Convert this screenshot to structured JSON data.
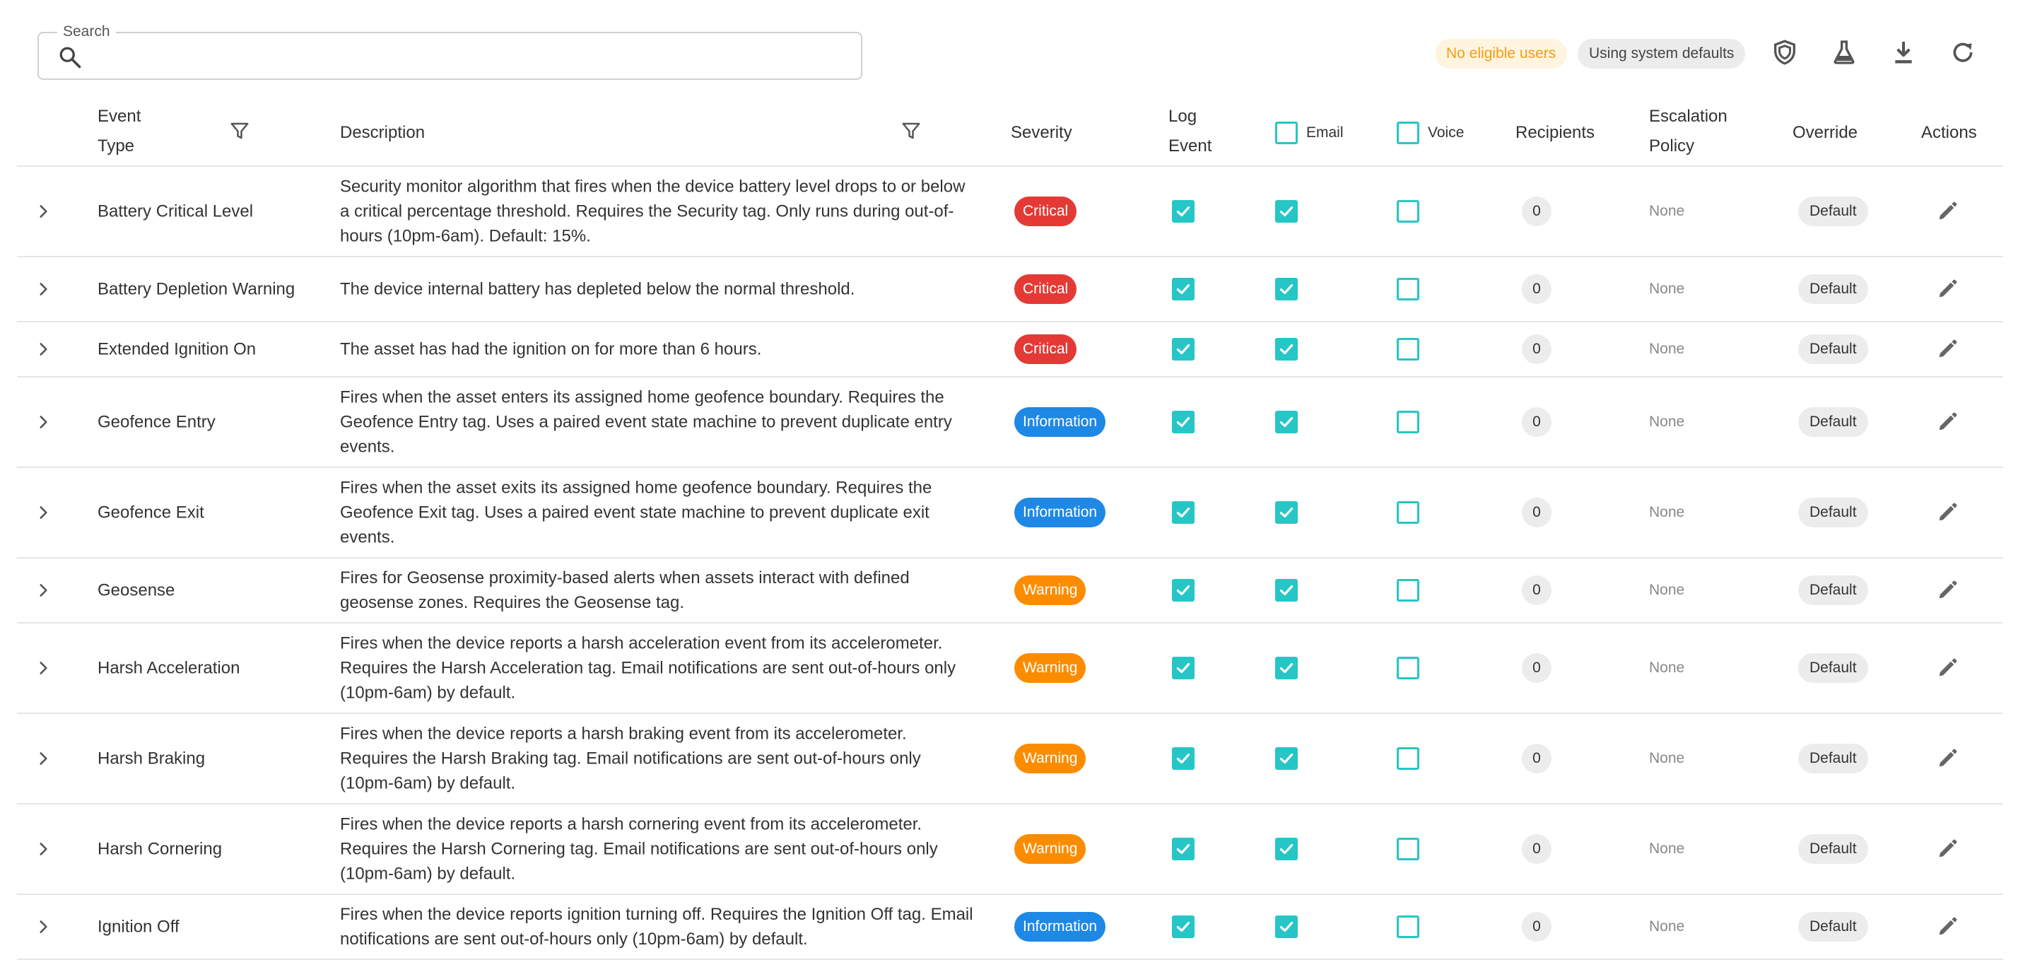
{
  "search": {
    "label": "Search",
    "placeholder": "",
    "value": ""
  },
  "toolbar": {
    "chip_warning": "No eligible users",
    "chip_defaults": "Using system defaults",
    "icons": [
      "shield-icon",
      "flask-icon",
      "download-icon",
      "refresh-icon"
    ]
  },
  "colors": {
    "accent": "#26c6c6",
    "critical": "#e53935",
    "information": "#1e88e5",
    "warning": "#fb8c00",
    "warning_text": "#f39c12"
  },
  "columns": {
    "event_type_1": "Event",
    "event_type_2": "Type",
    "description": "Description",
    "severity": "Severity",
    "log_event_1": "Log",
    "log_event_2": "Event",
    "email": "Email",
    "voice": "Voice",
    "recipients": "Recipients",
    "escalation_1": "Escalation",
    "escalation_2": "Policy",
    "override": "Override",
    "actions": "Actions"
  },
  "rows": [
    {
      "event_type": "Battery Critical Level",
      "description": "Security monitor algorithm that fires when the device battery level drops to or below a critical percentage threshold. Requires the Security tag. Only runs during out-of-hours (10pm-6am). Default: 15%.",
      "severity": "Critical",
      "log_event": true,
      "email": true,
      "voice": false,
      "recipients": "0",
      "escalation": "None",
      "override": "Default"
    },
    {
      "event_type": "Battery Depletion Warning",
      "description": "The device internal battery has depleted below the normal threshold.",
      "severity": "Critical",
      "log_event": true,
      "email": true,
      "voice": false,
      "recipients": "0",
      "escalation": "None",
      "override": "Default"
    },
    {
      "event_type": "Extended Ignition On",
      "description": "The asset has had the ignition on for more than 6 hours.",
      "severity": "Critical",
      "log_event": true,
      "email": true,
      "voice": false,
      "recipients": "0",
      "escalation": "None",
      "override": "Default"
    },
    {
      "event_type": "Geofence Entry",
      "description": "Fires when the asset enters its assigned home geofence boundary. Requires the Geofence Entry tag. Uses a paired event state machine to prevent duplicate entry events.",
      "severity": "Information",
      "log_event": true,
      "email": true,
      "voice": false,
      "recipients": "0",
      "escalation": "None",
      "override": "Default"
    },
    {
      "event_type": "Geofence Exit",
      "description": "Fires when the asset exits its assigned home geofence boundary. Requires the Geofence Exit tag. Uses a paired event state machine to prevent duplicate exit events.",
      "severity": "Information",
      "log_event": true,
      "email": true,
      "voice": false,
      "recipients": "0",
      "escalation": "None",
      "override": "Default"
    },
    {
      "event_type": "Geosense",
      "description": "Fires for Geosense proximity-based alerts when assets interact with defined geosense zones. Requires the Geosense tag.",
      "severity": "Warning",
      "log_event": true,
      "email": true,
      "voice": false,
      "recipients": "0",
      "escalation": "None",
      "override": "Default"
    },
    {
      "event_type": "Harsh Acceleration",
      "description": "Fires when the device reports a harsh acceleration event from its accelerometer. Requires the Harsh Acceleration tag. Email notifications are sent out-of-hours only (10pm-6am) by default.",
      "severity": "Warning",
      "log_event": true,
      "email": true,
      "voice": false,
      "recipients": "0",
      "escalation": "None",
      "override": "Default"
    },
    {
      "event_type": "Harsh Braking",
      "description": "Fires when the device reports a harsh braking event from its accelerometer. Requires the Harsh Braking tag. Email notifications are sent out-of-hours only (10pm-6am) by default.",
      "severity": "Warning",
      "log_event": true,
      "email": true,
      "voice": false,
      "recipients": "0",
      "escalation": "None",
      "override": "Default"
    },
    {
      "event_type": "Harsh Cornering",
      "description": "Fires when the device reports a harsh cornering event from its accelerometer. Requires the Harsh Cornering tag. Email notifications are sent out-of-hours only (10pm-6am) by default.",
      "severity": "Warning",
      "log_event": true,
      "email": true,
      "voice": false,
      "recipients": "0",
      "escalation": "None",
      "override": "Default"
    },
    {
      "event_type": "Ignition Off",
      "description": "Fires when the device reports ignition turning off. Requires the Ignition Off tag. Email notifications are sent out-of-hours only (10pm-6am) by default.",
      "severity": "Information",
      "log_event": true,
      "email": true,
      "voice": false,
      "recipients": "0",
      "escalation": "None",
      "override": "Default"
    }
  ]
}
